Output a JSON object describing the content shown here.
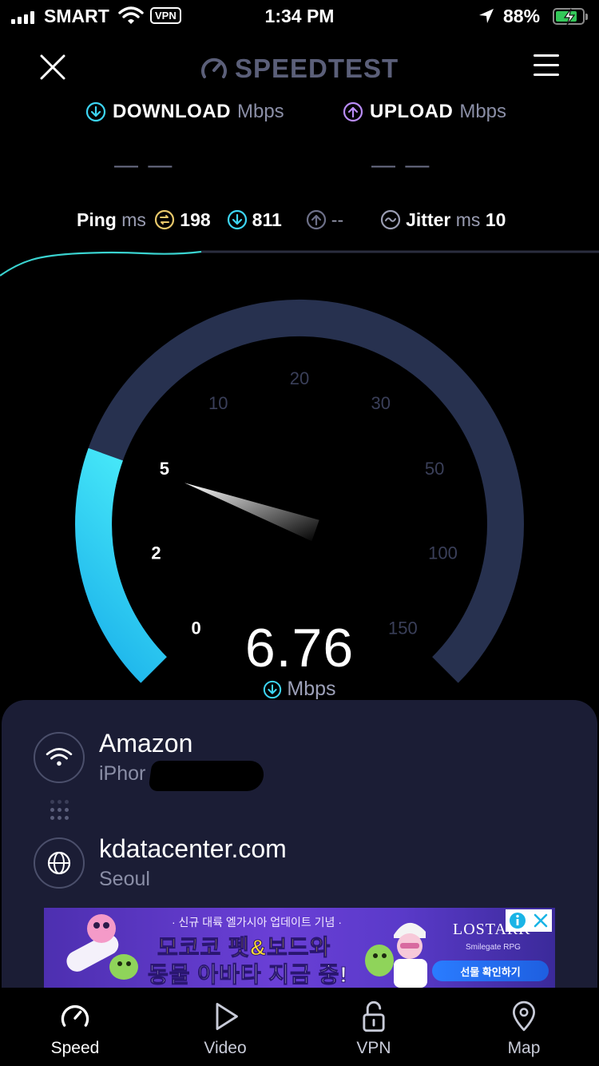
{
  "status_bar": {
    "carrier": "SMART",
    "vpn_badge": "VPN",
    "time": "1:34 PM",
    "battery": "88%",
    "battery_level": 0.88
  },
  "header": {
    "title": "SPEEDTEST",
    "close_icon": "close-icon",
    "menu_icon": "hamburger-menu-icon"
  },
  "metrics": {
    "download": {
      "label": "DOWNLOAD",
      "unit": "Mbps",
      "value": "— —"
    },
    "upload": {
      "label": "UPLOAD",
      "unit": "Mbps",
      "value": "— —"
    }
  },
  "ping": {
    "label": "Ping",
    "unit": "ms",
    "idle": "198",
    "download": "811",
    "upload": "--",
    "jitter_label": "Jitter",
    "jitter_unit": "ms",
    "jitter": "10"
  },
  "gauge": {
    "ticks": [
      "0",
      "2",
      "5",
      "10",
      "20",
      "30",
      "50",
      "100",
      "150"
    ],
    "speed": "6.76",
    "unit": "Mbps",
    "progress_fraction": 0.24
  },
  "connection": {
    "provider": "Amazon",
    "device": "iPhor",
    "server": "kdatacenter.com",
    "city": "Seoul"
  },
  "ad": {
    "top_line": "· 신규 대륙 엘가시아 업데이트 기념 ·",
    "line1": "모코코 펫&보드와",
    "line2": "동물 아바타 지금 중!",
    "brand": "LOSTARK",
    "brand_sub": "Smilegate RPG",
    "cta": "선물 확인하기"
  },
  "tabs": [
    {
      "label": "Speed",
      "icon": "speedometer-icon"
    },
    {
      "label": "Video",
      "icon": "play-icon"
    },
    {
      "label": "VPN",
      "icon": "lock-icon"
    },
    {
      "label": "Map",
      "icon": "map-pin-icon"
    }
  ],
  "colors": {
    "accent_cyan": "#3dd6f5",
    "gauge_track": "#27314f",
    "upload_purple": "#b98cf7",
    "card_bg": "#1b1d35"
  }
}
